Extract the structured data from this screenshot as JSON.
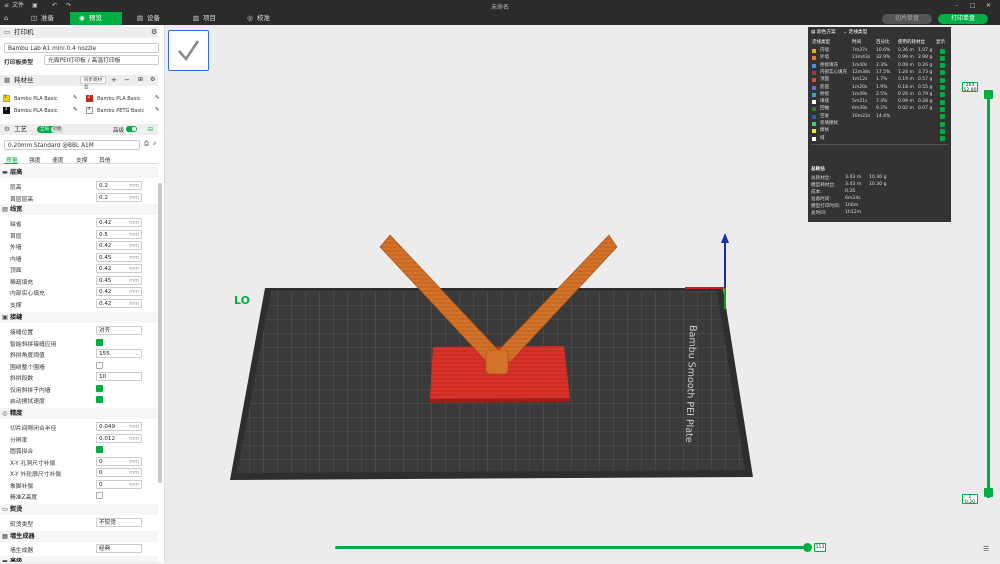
{
  "titlebar": {
    "file_menu": "文件",
    "title": "未命名"
  },
  "nav": {
    "tabs": [
      {
        "label": "准备",
        "active": false
      },
      {
        "label": "预览",
        "active": true
      },
      {
        "label": "设备",
        "active": false
      },
      {
        "label": "项目",
        "active": false
      },
      {
        "label": "校准",
        "active": false
      }
    ],
    "slice_plate": "切片单盘",
    "print_plate": "打印单盘"
  },
  "printer": {
    "title": "打印机",
    "model": "Bambu Lab A1 mini 0.4 nozzle",
    "plate_label": "打印板类型",
    "plate_value": "光面PEI打印板 / 高温打印板"
  },
  "filament": {
    "title": "耗材丝",
    "sync_button": "同步耗材丝",
    "slots": [
      {
        "num": "1",
        "name": "Bambu PLA Basic",
        "color": "#f2d400"
      },
      {
        "num": "2",
        "name": "Bambu PLA Basic",
        "color": "#c62a1c"
      },
      {
        "num": "3",
        "name": "Bambu PLA Basic",
        "color": "#111111"
      },
      {
        "num": "4",
        "name": "Bambu PETG Basic",
        "color": "#ffffff"
      }
    ]
  },
  "process": {
    "title": "工艺",
    "mode_global": "全局",
    "mode_object": "对象",
    "advanced": "高级",
    "preset": "0.20mm Standard @BBL A1M",
    "subtabs": [
      "质量",
      "强度",
      "速度",
      "支撑",
      "其他"
    ],
    "groups": {
      "layer_height": {
        "title": "层高",
        "rows": [
          {
            "label": "层高",
            "value": "0.2",
            "unit": "mm"
          },
          {
            "label": "首层层高",
            "value": "0.2",
            "unit": "mm"
          }
        ]
      },
      "line_width": {
        "title": "线宽",
        "rows": [
          {
            "label": "缺省",
            "value": "0.42",
            "unit": "mm"
          },
          {
            "label": "首层",
            "value": "0.5",
            "unit": "mm"
          },
          {
            "label": "外墙",
            "value": "0.42",
            "unit": "mm"
          },
          {
            "label": "内墙",
            "value": "0.45",
            "unit": "mm"
          },
          {
            "label": "顶面",
            "value": "0.42",
            "unit": "mm"
          },
          {
            "label": "稀疏填充",
            "value": "0.45",
            "unit": "mm"
          },
          {
            "label": "内部实心填充",
            "value": "0.42",
            "unit": "mm"
          },
          {
            "label": "支撑",
            "value": "0.42",
            "unit": "mm"
          }
        ]
      },
      "seam": {
        "title": "接缝",
        "rows": [
          {
            "label": "接缝位置",
            "value": "对齐",
            "type": "select"
          },
          {
            "label": "智能斜拼接缝应用",
            "type": "check",
            "on": true
          },
          {
            "label": "斜拼角度阈值",
            "value": "155",
            "type": "select"
          },
          {
            "label": "围绕整个围墙",
            "type": "check",
            "on": false
          },
          {
            "label": "斜拼段数",
            "value": "10"
          },
          {
            "label": "仅用斜拼于内墙",
            "type": "check",
            "on": true
          },
          {
            "label": "启动擦拭速度",
            "type": "check",
            "on": true
          }
        ]
      },
      "precision": {
        "title": "精度",
        "rows": [
          {
            "label": "切片间隙闭合半径",
            "value": "0.049",
            "unit": "mm"
          },
          {
            "label": "分辨率",
            "value": "0.012",
            "unit": "mm"
          },
          {
            "label": "圆弧拟合",
            "type": "check",
            "on": true
          },
          {
            "label": "X-Y 孔洞尺寸补偿",
            "value": "0",
            "unit": "mm"
          },
          {
            "label": "X-Y 外轮廓尺寸补偿",
            "value": "0",
            "unit": "mm"
          },
          {
            "label": "象脚补偿",
            "value": "0",
            "unit": "mm"
          },
          {
            "label": "精准Z高度",
            "type": "check",
            "on": false
          }
        ]
      },
      "ironing": {
        "title": "熨烫",
        "rows": [
          {
            "label": "熨烫类型",
            "value": "不熨烫",
            "type": "select"
          }
        ]
      },
      "wall_gen": {
        "title": "墙生成器",
        "rows": [
          {
            "label": "墙生成器",
            "value": "经典",
            "type": "select"
          }
        ]
      },
      "advanced_grp": {
        "title": "高级"
      }
    }
  },
  "legend": {
    "scheme_label": "颜色方案",
    "scheme_value": "走线类型",
    "columns": [
      "走线类型",
      "时间",
      "百分比",
      "使用的耗材丝",
      "显示"
    ],
    "rows": [
      {
        "name": "内墙",
        "time": "7m37s",
        "pct": "10.6%",
        "used": "0.36 m",
        "g": "1.07 g",
        "color": "#e8a53a"
      },
      {
        "name": "外墙",
        "time": "23m43s",
        "pct": "32.9%",
        "used": "0.99 m",
        "g": "2.98 g",
        "color": "#e07a2e"
      },
      {
        "name": "桥接填充",
        "time": "1m40s",
        "pct": "2.3%",
        "used": "0.09 m",
        "g": "0.26 g",
        "color": "#4a8fd9"
      },
      {
        "name": "内部实心填充",
        "time": "12m38s",
        "pct": "17.5%",
        "used": "1.24 m",
        "g": "3.73 g",
        "color": "#a0325a"
      },
      {
        "name": "顶面",
        "time": "1m12s",
        "pct": "1.7%",
        "used": "0.19 m",
        "g": "0.57 g",
        "color": "#d94a3a"
      },
      {
        "name": "底面",
        "time": "1m20s",
        "pct": "1.9%",
        "used": "0.18 m",
        "g": "0.55 g",
        "color": "#6b6bd6"
      },
      {
        "name": "桥接",
        "time": "1m49s",
        "pct": "2.5%",
        "used": "0.26 m",
        "g": "0.79 g",
        "color": "#3aa0c8"
      },
      {
        "name": "填缝",
        "time": "5m21s",
        "pct": "7.4%",
        "used": "0.09 m",
        "g": "0.28 g",
        "color": "#ffffff"
      },
      {
        "name": "回抽",
        "time": "6m39s",
        "pct": "9.2%",
        "used": "0.02 m",
        "g": "0.07 g",
        "color": "#2e7d3a"
      },
      {
        "name": "空驶",
        "time": "10m22s",
        "pct": "14.4%",
        "used": "",
        "g": "",
        "color": "#2a5caa"
      },
      {
        "name": "装填擦拭",
        "time": "",
        "pct": "",
        "used": "",
        "g": "",
        "color": "#50c878"
      },
      {
        "name": "擦拭",
        "time": "",
        "pct": "",
        "used": "",
        "g": "",
        "color": "#f0e040"
      },
      {
        "name": "缝",
        "time": "",
        "pct": "",
        "used": "",
        "g": "",
        "color": "#ffffff"
      }
    ],
    "summary_title": "总耗估",
    "summary": [
      {
        "k": "总耗材丝:",
        "v1": "3.43 m",
        "v2": "10.30 g"
      },
      {
        "k": "模型耗材丝:",
        "v1": "3.43 m",
        "v2": "10.30 g"
      },
      {
        "k": "成本:",
        "v1": "0.26",
        "v2": ""
      },
      {
        "k": "准备时间:",
        "v1": "6m24s",
        "v2": ""
      },
      {
        "k": "模型打印时间:",
        "v1": "1h6m",
        "v2": ""
      },
      {
        "k": "总时间:",
        "v1": "1h12m",
        "v2": ""
      }
    ]
  },
  "layer_slider": {
    "top_value": "264",
    "top_height": "52.80",
    "bottom_value": "1",
    "bottom_height": "0.20"
  },
  "move_slider": {
    "value": "113"
  },
  "plate_marks": {
    "label_left": "LO",
    "label_right": "Bambu Smooth PEI Plate"
  },
  "colors": {
    "accent": "#00ae42",
    "dark": "#2b2b2b"
  }
}
